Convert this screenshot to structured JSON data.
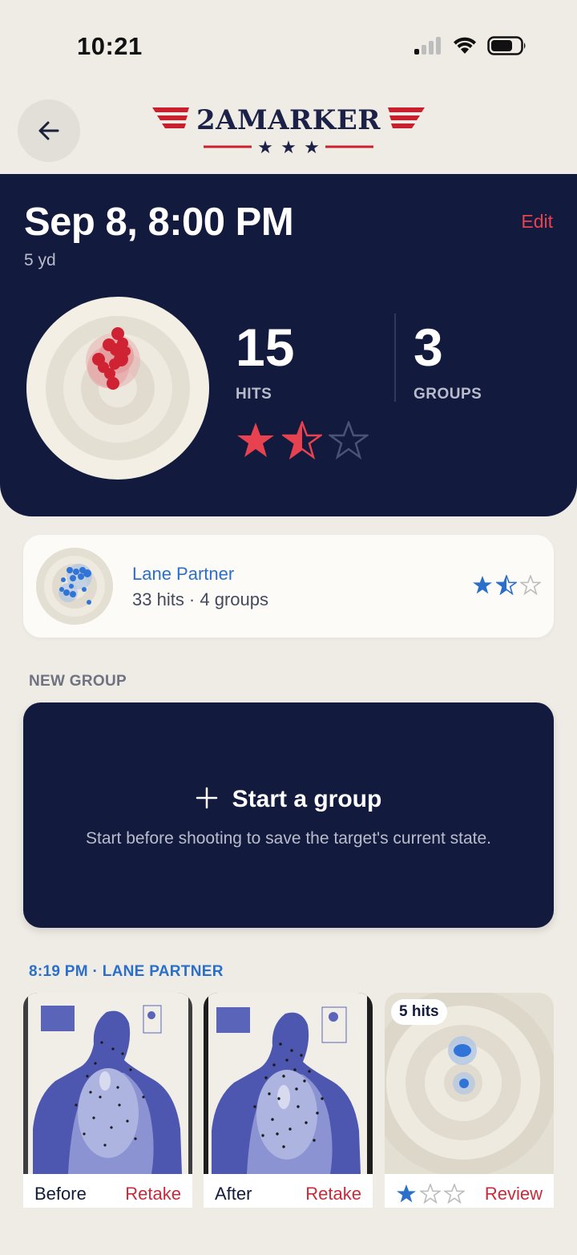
{
  "status_bar": {
    "time": "10:21"
  },
  "header": {
    "logo_text": "2AMARKER"
  },
  "session": {
    "title": "Sep 8, 8:00 PM",
    "distance": "5 yd",
    "edit_label": "Edit",
    "hits_count": "15",
    "hits_label": "HITS",
    "groups_count": "3",
    "groups_label": "GROUPS",
    "rating": 1.5,
    "rating_max": 3
  },
  "partner": {
    "name": "Lane Partner",
    "meta": "33 hits · 4 groups",
    "rating": 1.5,
    "rating_max": 3
  },
  "new_group": {
    "section_label": "NEW GROUP",
    "title": "Start a group",
    "description": "Start before shooting to save the target's current state."
  },
  "history": {
    "label": "8:19 PM · LANE PARTNER",
    "tiles": [
      {
        "label": "Before",
        "action": "Retake"
      },
      {
        "label": "After",
        "action": "Retake"
      },
      {
        "badge": "5 hits",
        "rating": 1,
        "rating_max": 3,
        "action": "Review"
      }
    ]
  },
  "colors": {
    "navy": "#121b3e",
    "red": "#e8414f",
    "blue": "#2a6fc9",
    "background": "#efebe5"
  },
  "icons": {
    "back": "arrow-left-icon",
    "signal": "cellular-signal-icon",
    "wifi": "wifi-icon",
    "battery": "battery-icon",
    "plus": "plus-icon",
    "star": "star-icon"
  }
}
